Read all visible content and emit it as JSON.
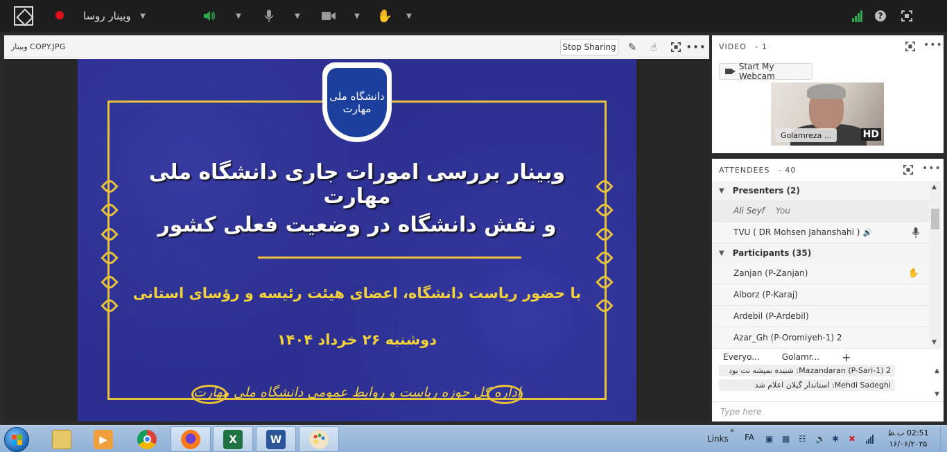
{
  "topbar": {
    "meeting_title": "وبینار روسا",
    "colors": {
      "background": "#1d1d1d",
      "record": "#e0101a",
      "audio_active": "#2fa84f",
      "signal": "#2fa84f"
    },
    "icons": [
      "app-logo-icon",
      "record-icon",
      "chevron-down-icon",
      "speaker-icon",
      "microphone-icon",
      "camera-icon",
      "raise-hand-icon",
      "signal-bars-icon",
      "help-icon",
      "fullscreen-icon"
    ]
  },
  "share": {
    "title": "وبینار COPY.JPG",
    "stop_label": "Stop Sharing"
  },
  "slide": {
    "logo_text": "دانشگاه ملی مهارت",
    "line1": "وبینار بررسی امورات جاری دانشگاه ملی مهارت",
    "line2": "و نقش دانشگاه در وضعیت فعلی کشور",
    "line3": "با حضور ریاست دانشگاه، اعضای هیئت رئیسه و رؤسای استانی",
    "line4": "دوشنبه ۲۶ خرداد ۱۴۰۴",
    "footer": "اداره کل حوزه ریاست و روابط عمومی دانشگاه ملی مهارت",
    "colors": {
      "background": "#2c2f8f",
      "gold": "#e8c23a",
      "text": "#ffffff"
    }
  },
  "video": {
    "header": "VIDEO",
    "count": "- 1",
    "webcam_label": "Start My Webcam",
    "tile_name": "Golamreza ...",
    "hd_label": "HD"
  },
  "attendees": {
    "header": "ATTENDEES",
    "count": "- 40",
    "presenters_label": "Presenters (2)",
    "participants_label": "Participants (35)",
    "presenters": [
      {
        "name": "Ali Seyf",
        "tag": "You"
      },
      {
        "name": "TVU ( DR Mohsen Jahanshahi )"
      }
    ],
    "participants": [
      {
        "name": "Zanjan (P-Zanjan)"
      },
      {
        "name": "Alborz (P-Karaj)"
      },
      {
        "name": "Ardebil (P-Ardebil)"
      },
      {
        "name": "Azar_Gh (P-Oromiyeh-1) 2"
      }
    ]
  },
  "chat": {
    "tabs": [
      "Everyo...",
      "Golamr...",
      "+"
    ],
    "messages": [
      {
        "text": "Mazandaran (P-Sari-1) 2: شنیده نمیشه نت بود"
      },
      {
        "text": "Mehdi Sadeghi: استاندار گیلان اعلام شد"
      }
    ],
    "input_placeholder": "Type here"
  },
  "taskbar": {
    "links_label": "Links",
    "lang_label": "FA",
    "time": "02:51 ب.ظ",
    "date": "۱۶/۰۶/۲۰۲۵",
    "apps": [
      {
        "name": "file-explorer",
        "letter": ""
      },
      {
        "name": "media-player",
        "letter": ""
      },
      {
        "name": "chrome",
        "letter": ""
      },
      {
        "name": "firefox",
        "letter": ""
      },
      {
        "name": "excel",
        "letter": "X"
      },
      {
        "name": "word",
        "letter": "W"
      },
      {
        "name": "paint",
        "letter": ""
      }
    ]
  }
}
